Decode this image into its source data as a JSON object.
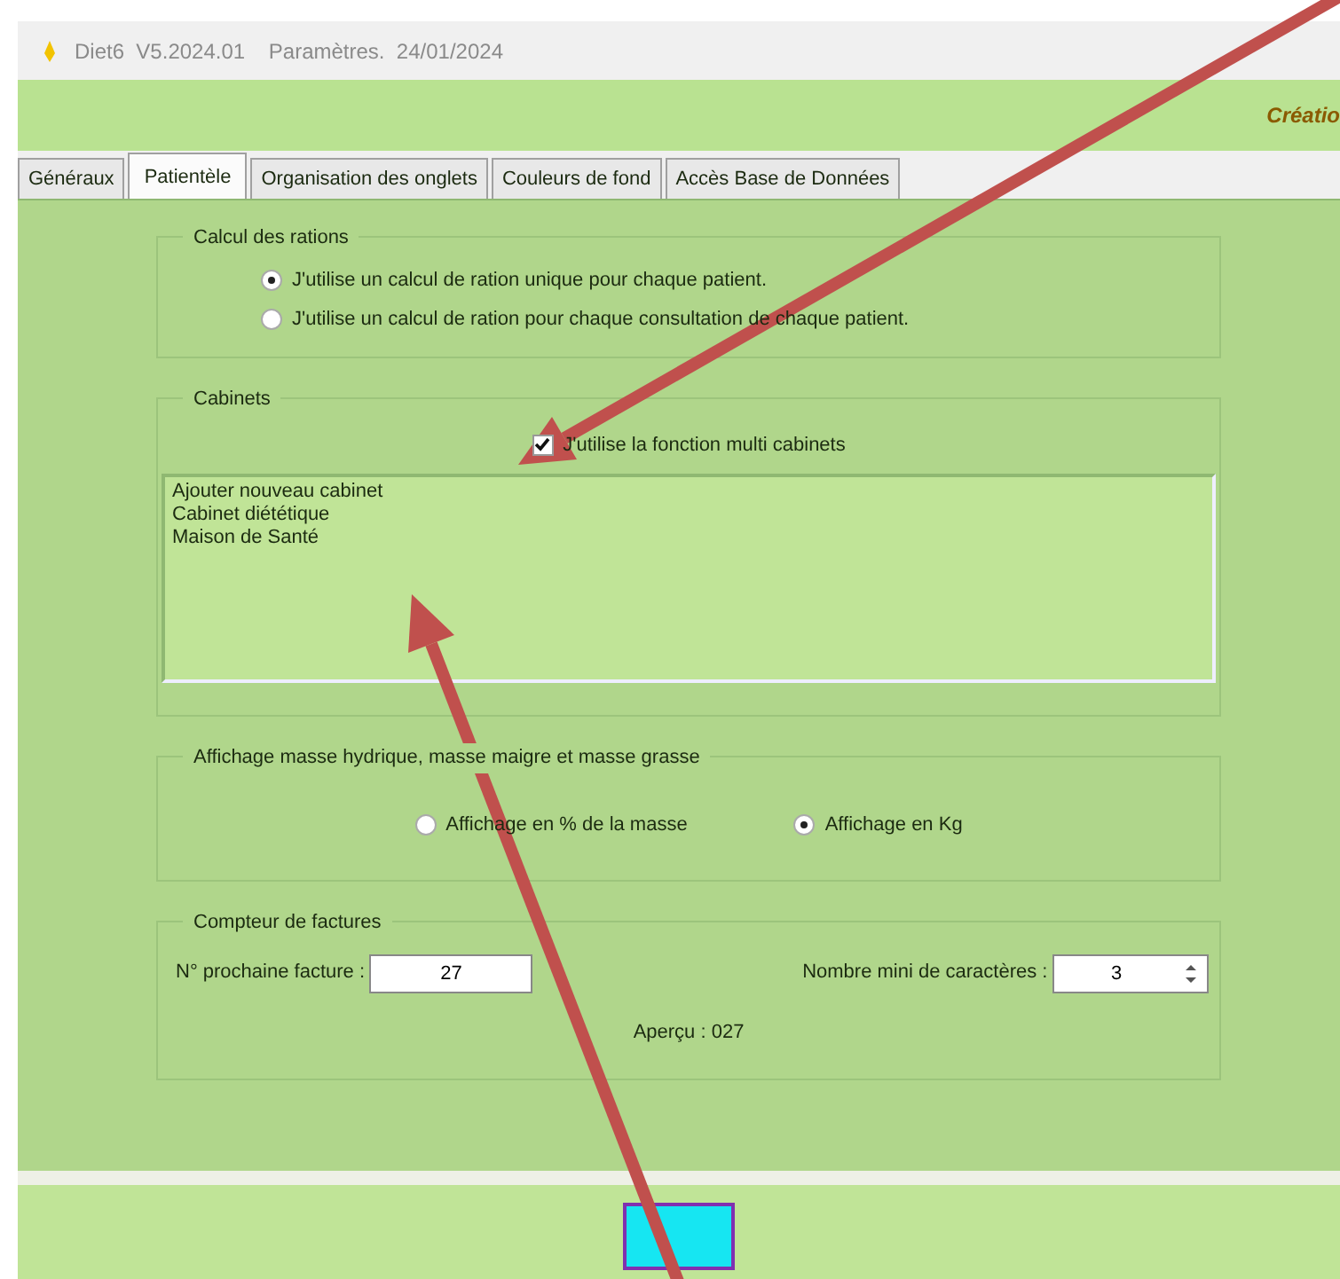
{
  "window": {
    "title": "Diet6  V5.2024.01    Paramètres.  24/01/2024"
  },
  "header_text": "Créatio",
  "tabs": [
    {
      "label": "Généraux",
      "selected": false
    },
    {
      "label": "Patientèle",
      "selected": true
    },
    {
      "label": "Organisation des onglets",
      "selected": false
    },
    {
      "label": "Couleurs de fond",
      "selected": false
    },
    {
      "label": "Accès Base de Données",
      "selected": false
    }
  ],
  "groups": [
    {
      "kind": "radios",
      "title": "Calcul des rations",
      "options": [
        {
          "label": "J'utilise un calcul de ration unique pour chaque patient.",
          "selected": true
        },
        {
          "label": "J'utilise un calcul de ration pour chaque consultation de chaque patient.",
          "selected": false
        }
      ]
    },
    {
      "kind": "cabinets",
      "title": "Cabinets",
      "checkbox": {
        "label": "J'utilise la fonction multi cabinets",
        "checked": true
      },
      "items": [
        "Ajouter nouveau cabinet",
        "Cabinet diététique",
        "Maison de Santé"
      ]
    },
    {
      "kind": "inline_radios",
      "title": "Affichage masse hydrique, masse maigre et masse grasse",
      "options": [
        {
          "label": "Affichage en % de la masse",
          "selected": false
        },
        {
          "label": "Affichage en Kg",
          "selected": true
        }
      ]
    },
    {
      "kind": "counter",
      "title": "Compteur de factures",
      "next_label": "N° prochaine facture :",
      "next_value": "27",
      "min_label": "Nombre mini de caractères :",
      "min_value": "3",
      "preview": "Aperçu : 027"
    }
  ],
  "annotations": [
    {
      "kind": "arrow"
    },
    {
      "kind": "arrow"
    }
  ]
}
